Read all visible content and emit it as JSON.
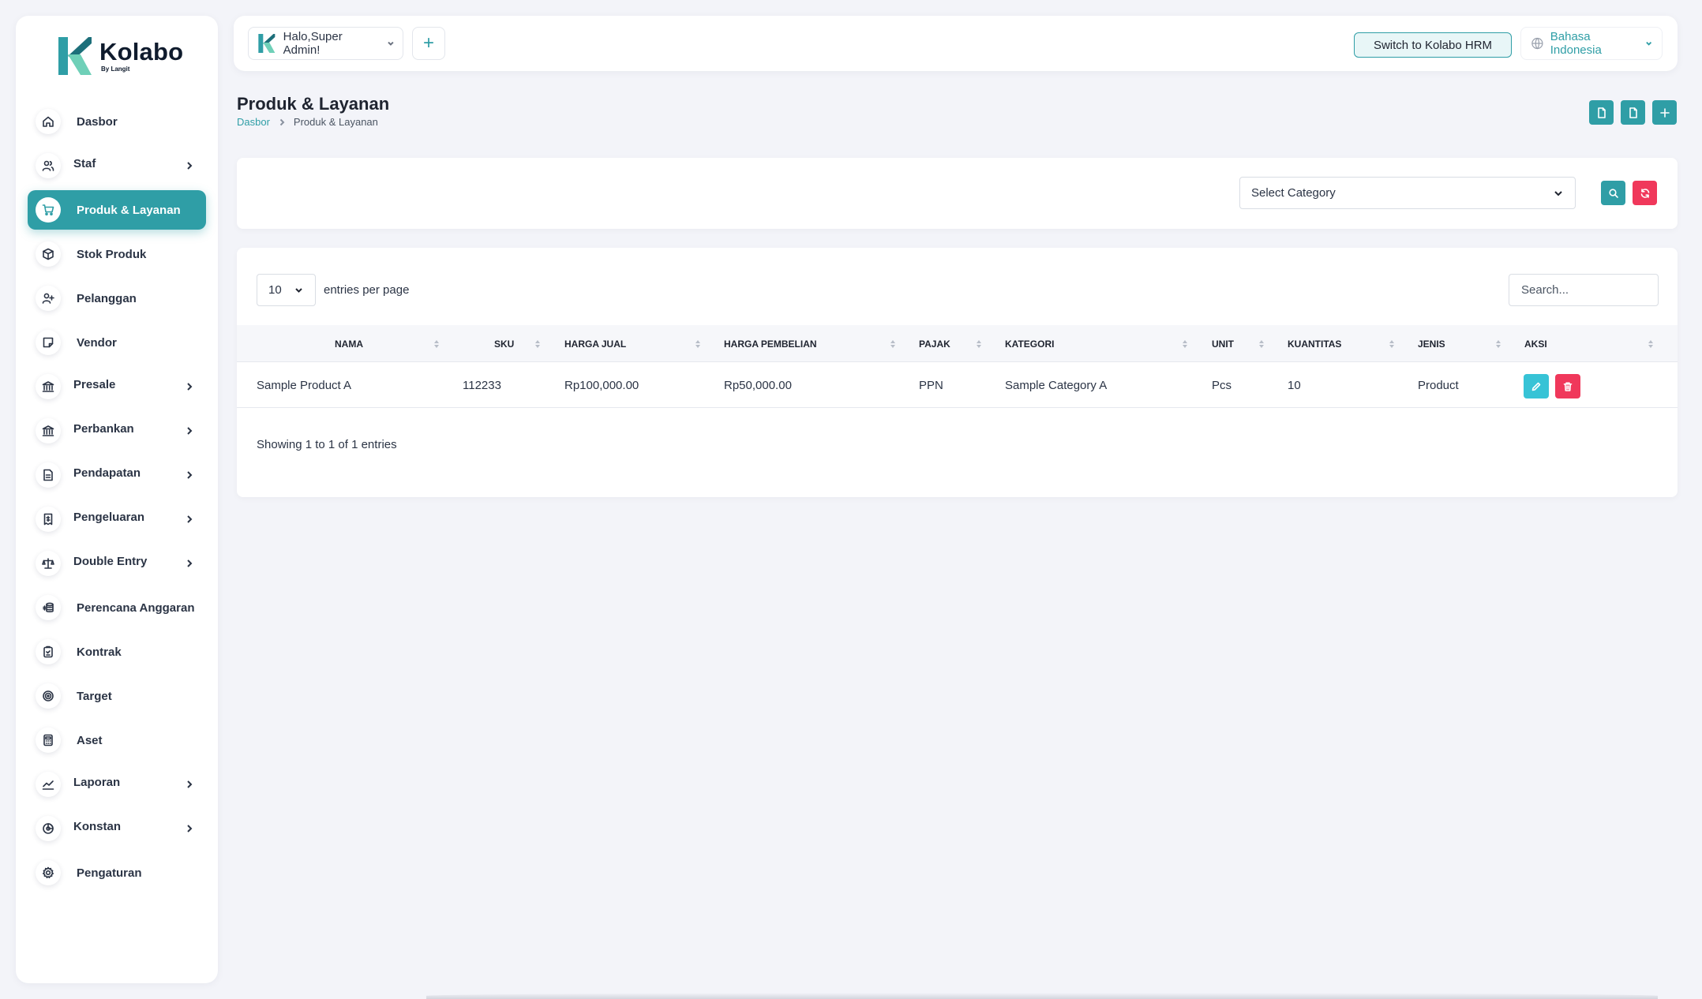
{
  "brand": {
    "name": "Kolabo",
    "sub": "By Langit",
    "color": "#2f9ea6"
  },
  "sidebar": {
    "items": [
      {
        "label": "Dasbor",
        "icon": "home-icon",
        "has_sub": false,
        "active": false
      },
      {
        "label": "Staf",
        "icon": "users-icon",
        "has_sub": true,
        "active": false
      },
      {
        "label": "Produk & Layanan",
        "icon": "cart-icon",
        "has_sub": false,
        "active": true
      },
      {
        "label": "Stok Produk",
        "icon": "box-icon",
        "has_sub": false,
        "active": false
      },
      {
        "label": "Pelanggan",
        "icon": "user-plus-icon",
        "has_sub": false,
        "active": false
      },
      {
        "label": "Vendor",
        "icon": "note-icon",
        "has_sub": false,
        "active": false
      },
      {
        "label": "Presale",
        "icon": "bank-icon",
        "has_sub": true,
        "active": false
      },
      {
        "label": "Perbankan",
        "icon": "bank-icon",
        "has_sub": true,
        "active": false
      },
      {
        "label": "Pendapatan",
        "icon": "file-text-icon",
        "has_sub": true,
        "active": false
      },
      {
        "label": "Pengeluaran",
        "icon": "receipt-icon",
        "has_sub": true,
        "active": false
      },
      {
        "label": "Double Entry",
        "icon": "scale-icon",
        "has_sub": true,
        "active": false
      },
      {
        "label": "Perencana Anggaran",
        "icon": "coins-icon",
        "has_sub": false,
        "active": false
      },
      {
        "label": "Kontrak",
        "icon": "clipboard-icon",
        "has_sub": false,
        "active": false
      },
      {
        "label": "Target",
        "icon": "target-icon",
        "has_sub": false,
        "active": false
      },
      {
        "label": "Aset",
        "icon": "calculator-icon",
        "has_sub": false,
        "active": false
      },
      {
        "label": "Laporan",
        "icon": "chart-line-icon",
        "has_sub": true,
        "active": false
      },
      {
        "label": "Konstan",
        "icon": "constant-icon",
        "has_sub": true,
        "active": false
      },
      {
        "label": "Pengaturan",
        "icon": "gear-icon",
        "has_sub": false,
        "active": false
      }
    ]
  },
  "topbar": {
    "greeting": "Halo,Super Admin!",
    "switch_label": "Switch to Kolabo HRM",
    "language": "Bahasa Indonesia"
  },
  "page": {
    "title": "Produk & Layanan",
    "breadcrumb_home": "Dasbor",
    "breadcrumb_current": "Produk & Layanan"
  },
  "filter": {
    "category_placeholder": "Select Category"
  },
  "table": {
    "per_page": "10",
    "per_page_label": "entries per page",
    "search_placeholder": "Search...",
    "columns": [
      "NAMA",
      "SKU",
      "HARGA JUAL",
      "HARGA PEMBELIAN",
      "PAJAK",
      "KATEGORI",
      "UNIT",
      "KUANTITAS",
      "JENIS",
      "AKSI"
    ],
    "rows": [
      {
        "nama": "Sample Product A",
        "sku": "112233",
        "harga_jual": "Rp100,000.00",
        "harga_pembelian": "Rp50,000.00",
        "pajak": "PPN",
        "kategori": "Sample Category A",
        "unit": "Pcs",
        "kuantitas": "10",
        "jenis": "Product"
      }
    ],
    "showing": "Showing 1 to 1 of 1 entries"
  },
  "colors": {
    "accent": "#2f9ea6",
    "danger": "#f0385b",
    "edit": "#37c3d6",
    "background": "#f3f4f9"
  }
}
